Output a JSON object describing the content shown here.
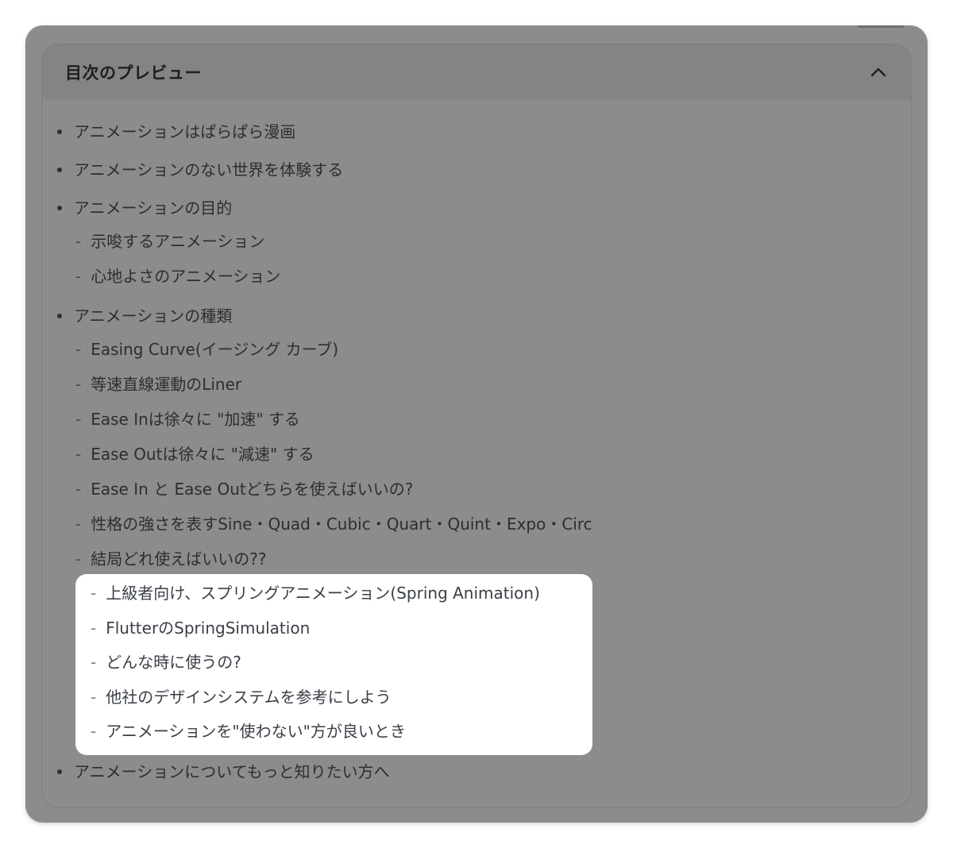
{
  "toc": {
    "title": "目次のプレビュー",
    "collapse_icon": "chevron-up-icon",
    "items": [
      {
        "level": 1,
        "label": "アニメーションはぱらぱら漫画"
      },
      {
        "level": 1,
        "label": "アニメーションのない世界を体験する"
      },
      {
        "level": 1,
        "label": "アニメーションの目的"
      },
      {
        "level": 2,
        "label": "示唆するアニメーション"
      },
      {
        "level": 2,
        "label": "心地よさのアニメーション"
      },
      {
        "level": 1,
        "label": "アニメーションの種類"
      },
      {
        "level": 2,
        "label": "Easing Curve(イージング カーブ)"
      },
      {
        "level": 2,
        "label": "等速直線運動のLiner"
      },
      {
        "level": 2,
        "label": "Ease Inは徐々に \"加速\" する"
      },
      {
        "level": 2,
        "label": "Ease Outは徐々に \"減速\" する"
      },
      {
        "level": 2,
        "label": "Ease In と Ease Outどちらを使えばいいの?"
      },
      {
        "level": 2,
        "label": "性格の強さを表すSine・Quad・Cubic・Quart・Quint・Expo・Circ"
      },
      {
        "level": 2,
        "label": "結局どれ使えばいいの??"
      }
    ],
    "highlighted_items": [
      {
        "level": 2,
        "label": "上級者向け、スプリングアニメーション(Spring Animation)"
      },
      {
        "level": 2,
        "label": "FlutterのSpringSimulation"
      },
      {
        "level": 2,
        "label": "どんな時に使うの?"
      },
      {
        "level": 2,
        "label": "他社のデザインシステムを参考にしよう"
      },
      {
        "level": 2,
        "label": "アニメーションを\"使わない\"方が良いとき"
      }
    ],
    "final_item": {
      "level": 1,
      "label": "アニメーションについてもっと知りたい方へ"
    }
  },
  "colors": {
    "overlay": "#8c8c8c",
    "header": "#848484",
    "highlight": "#ffffff",
    "text": "#2e2e2e"
  }
}
